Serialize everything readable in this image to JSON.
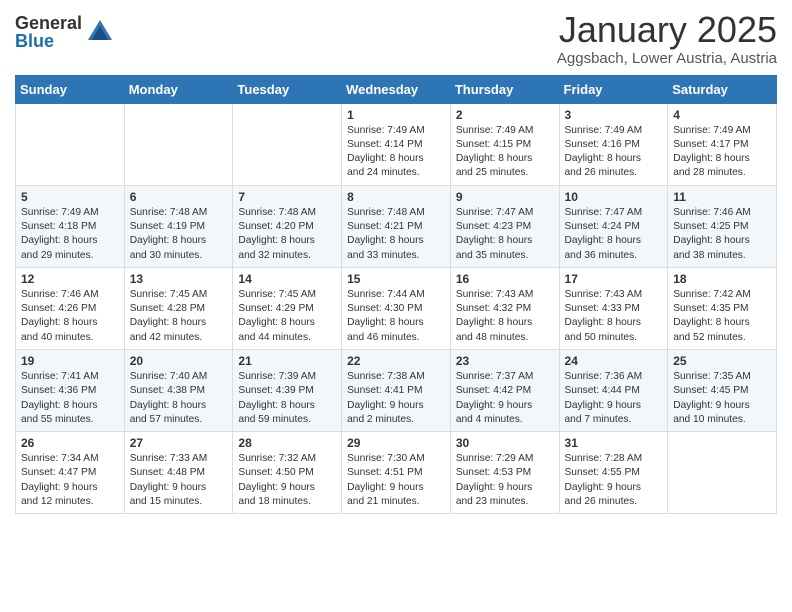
{
  "header": {
    "logo_general": "General",
    "logo_blue": "Blue",
    "month_title": "January 2025",
    "location": "Aggsbach, Lower Austria, Austria"
  },
  "weekdays": [
    "Sunday",
    "Monday",
    "Tuesday",
    "Wednesday",
    "Thursday",
    "Friday",
    "Saturday"
  ],
  "weeks": [
    [
      {
        "day": "",
        "info": ""
      },
      {
        "day": "",
        "info": ""
      },
      {
        "day": "",
        "info": ""
      },
      {
        "day": "1",
        "info": "Sunrise: 7:49 AM\nSunset: 4:14 PM\nDaylight: 8 hours\nand 24 minutes."
      },
      {
        "day": "2",
        "info": "Sunrise: 7:49 AM\nSunset: 4:15 PM\nDaylight: 8 hours\nand 25 minutes."
      },
      {
        "day": "3",
        "info": "Sunrise: 7:49 AM\nSunset: 4:16 PM\nDaylight: 8 hours\nand 26 minutes."
      },
      {
        "day": "4",
        "info": "Sunrise: 7:49 AM\nSunset: 4:17 PM\nDaylight: 8 hours\nand 28 minutes."
      }
    ],
    [
      {
        "day": "5",
        "info": "Sunrise: 7:49 AM\nSunset: 4:18 PM\nDaylight: 8 hours\nand 29 minutes."
      },
      {
        "day": "6",
        "info": "Sunrise: 7:48 AM\nSunset: 4:19 PM\nDaylight: 8 hours\nand 30 minutes."
      },
      {
        "day": "7",
        "info": "Sunrise: 7:48 AM\nSunset: 4:20 PM\nDaylight: 8 hours\nand 32 minutes."
      },
      {
        "day": "8",
        "info": "Sunrise: 7:48 AM\nSunset: 4:21 PM\nDaylight: 8 hours\nand 33 minutes."
      },
      {
        "day": "9",
        "info": "Sunrise: 7:47 AM\nSunset: 4:23 PM\nDaylight: 8 hours\nand 35 minutes."
      },
      {
        "day": "10",
        "info": "Sunrise: 7:47 AM\nSunset: 4:24 PM\nDaylight: 8 hours\nand 36 minutes."
      },
      {
        "day": "11",
        "info": "Sunrise: 7:46 AM\nSunset: 4:25 PM\nDaylight: 8 hours\nand 38 minutes."
      }
    ],
    [
      {
        "day": "12",
        "info": "Sunrise: 7:46 AM\nSunset: 4:26 PM\nDaylight: 8 hours\nand 40 minutes."
      },
      {
        "day": "13",
        "info": "Sunrise: 7:45 AM\nSunset: 4:28 PM\nDaylight: 8 hours\nand 42 minutes."
      },
      {
        "day": "14",
        "info": "Sunrise: 7:45 AM\nSunset: 4:29 PM\nDaylight: 8 hours\nand 44 minutes."
      },
      {
        "day": "15",
        "info": "Sunrise: 7:44 AM\nSunset: 4:30 PM\nDaylight: 8 hours\nand 46 minutes."
      },
      {
        "day": "16",
        "info": "Sunrise: 7:43 AM\nSunset: 4:32 PM\nDaylight: 8 hours\nand 48 minutes."
      },
      {
        "day": "17",
        "info": "Sunrise: 7:43 AM\nSunset: 4:33 PM\nDaylight: 8 hours\nand 50 minutes."
      },
      {
        "day": "18",
        "info": "Sunrise: 7:42 AM\nSunset: 4:35 PM\nDaylight: 8 hours\nand 52 minutes."
      }
    ],
    [
      {
        "day": "19",
        "info": "Sunrise: 7:41 AM\nSunset: 4:36 PM\nDaylight: 8 hours\nand 55 minutes."
      },
      {
        "day": "20",
        "info": "Sunrise: 7:40 AM\nSunset: 4:38 PM\nDaylight: 8 hours\nand 57 minutes."
      },
      {
        "day": "21",
        "info": "Sunrise: 7:39 AM\nSunset: 4:39 PM\nDaylight: 8 hours\nand 59 minutes."
      },
      {
        "day": "22",
        "info": "Sunrise: 7:38 AM\nSunset: 4:41 PM\nDaylight: 9 hours\nand 2 minutes."
      },
      {
        "day": "23",
        "info": "Sunrise: 7:37 AM\nSunset: 4:42 PM\nDaylight: 9 hours\nand 4 minutes."
      },
      {
        "day": "24",
        "info": "Sunrise: 7:36 AM\nSunset: 4:44 PM\nDaylight: 9 hours\nand 7 minutes."
      },
      {
        "day": "25",
        "info": "Sunrise: 7:35 AM\nSunset: 4:45 PM\nDaylight: 9 hours\nand 10 minutes."
      }
    ],
    [
      {
        "day": "26",
        "info": "Sunrise: 7:34 AM\nSunset: 4:47 PM\nDaylight: 9 hours\nand 12 minutes."
      },
      {
        "day": "27",
        "info": "Sunrise: 7:33 AM\nSunset: 4:48 PM\nDaylight: 9 hours\nand 15 minutes."
      },
      {
        "day": "28",
        "info": "Sunrise: 7:32 AM\nSunset: 4:50 PM\nDaylight: 9 hours\nand 18 minutes."
      },
      {
        "day": "29",
        "info": "Sunrise: 7:30 AM\nSunset: 4:51 PM\nDaylight: 9 hours\nand 21 minutes."
      },
      {
        "day": "30",
        "info": "Sunrise: 7:29 AM\nSunset: 4:53 PM\nDaylight: 9 hours\nand 23 minutes."
      },
      {
        "day": "31",
        "info": "Sunrise: 7:28 AM\nSunset: 4:55 PM\nDaylight: 9 hours\nand 26 minutes."
      },
      {
        "day": "",
        "info": ""
      }
    ]
  ]
}
